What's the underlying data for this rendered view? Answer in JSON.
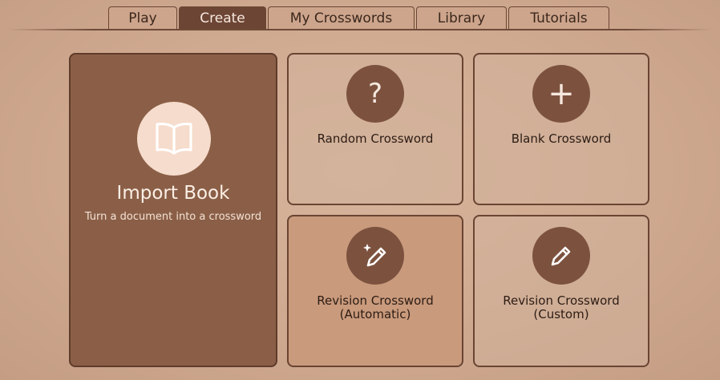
{
  "tabs": [
    {
      "label": "Play"
    },
    {
      "label": "Create",
      "active": true
    },
    {
      "label": "My Crosswords"
    },
    {
      "label": "Library"
    },
    {
      "label": "Tutorials"
    }
  ],
  "cards": {
    "import": {
      "title": "Import Book",
      "subtitle": "Turn a document into a crossword",
      "icon": "book-icon"
    },
    "random": {
      "title": "Random Crossword",
      "icon": "question-mark-icon",
      "glyph": "?"
    },
    "blank": {
      "title": "Blank Crossword",
      "icon": "plus-icon",
      "glyph": "+"
    },
    "revision_auto": {
      "title_line1": "Revision Crossword",
      "title_line2": "(Automatic)",
      "icon": "magic-pencil-icon"
    },
    "revision_custom": {
      "title_line1": "Revision Crossword",
      "title_line2": "(Custom)",
      "icon": "pencil-icon"
    }
  },
  "colors": {
    "active_tab": "#6d4534",
    "tab": "#cda58c",
    "import_card": "#8b5f47",
    "icon_circle": "#7c523f",
    "highlighted_card": "#c99a7c"
  }
}
